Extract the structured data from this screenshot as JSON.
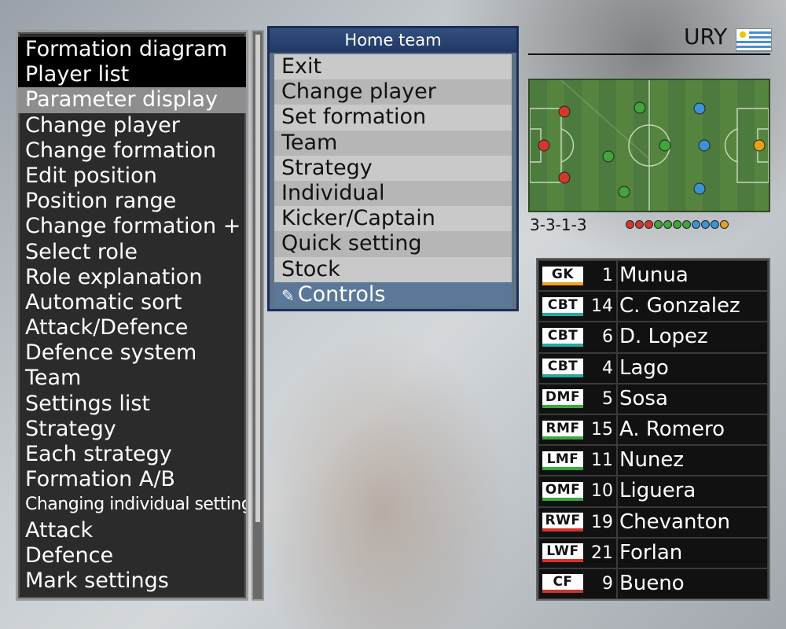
{
  "help_list": {
    "items": [
      {
        "label": "Formation diagram",
        "style": "dark"
      },
      {
        "label": "Player list",
        "style": "dark"
      },
      {
        "label": "Parameter display",
        "style": "hl"
      },
      {
        "label": "Change player",
        "style": ""
      },
      {
        "label": "Change formation",
        "style": ""
      },
      {
        "label": "Edit position",
        "style": ""
      },
      {
        "label": "Position range",
        "style": ""
      },
      {
        "label": "Change formation +",
        "style": ""
      },
      {
        "label": "Select role",
        "style": ""
      },
      {
        "label": "Role explanation",
        "style": ""
      },
      {
        "label": "Automatic sort",
        "style": ""
      },
      {
        "label": "Attack/Defence",
        "style": ""
      },
      {
        "label": "Defence system",
        "style": ""
      },
      {
        "label": "Team",
        "style": ""
      },
      {
        "label": "Settings list",
        "style": ""
      },
      {
        "label": "Strategy",
        "style": ""
      },
      {
        "label": "Each strategy",
        "style": ""
      },
      {
        "label": "Formation A/B",
        "style": ""
      },
      {
        "label": "Changing individual settings",
        "style": "small"
      },
      {
        "label": "Attack",
        "style": ""
      },
      {
        "label": "Defence",
        "style": ""
      },
      {
        "label": "Mark settings",
        "style": ""
      }
    ]
  },
  "menu": {
    "title": "Home team",
    "items": [
      "Exit",
      "Change player",
      "Set formation",
      "Team",
      "Strategy",
      "Individual",
      "Kicker/Captain",
      "Quick setting",
      "Stock"
    ],
    "controls_label": "Controls",
    "controls_icon": "controller-icon"
  },
  "team": {
    "code": "URY",
    "flag": "uruguay-flag"
  },
  "formation": {
    "label": "3-3-1-3",
    "dots": [
      {
        "color": "#d03a2c"
      },
      {
        "color": "#d03a2c"
      },
      {
        "color": "#d03a2c"
      },
      {
        "color": "#3fa63a"
      },
      {
        "color": "#3fa63a"
      },
      {
        "color": "#3fa63a"
      },
      {
        "color": "#3fa63a"
      },
      {
        "color": "#3b93d4"
      },
      {
        "color": "#3b93d4"
      },
      {
        "color": "#3b93d4"
      },
      {
        "color": "#e3a21a"
      }
    ]
  },
  "players": [
    {
      "pos": "GK",
      "num": "1",
      "name": "Munua",
      "line": "#f0a020"
    },
    {
      "pos": "CBT",
      "num": "14",
      "name": "C. Gonzalez",
      "line": "#2aa5a0"
    },
    {
      "pos": "CBT",
      "num": "6",
      "name": "D. Lopez",
      "line": "#2aa5a0"
    },
    {
      "pos": "CBT",
      "num": "4",
      "name": "Lago",
      "line": "#2aa5a0"
    },
    {
      "pos": "DMF",
      "num": "5",
      "name": "Sosa",
      "line": "#3aa83a"
    },
    {
      "pos": "RMF",
      "num": "15",
      "name": "A. Romero",
      "line": "#3aa83a"
    },
    {
      "pos": "LMF",
      "num": "11",
      "name": "Nunez",
      "line": "#3aa83a"
    },
    {
      "pos": "OMF",
      "num": "10",
      "name": "Liguera",
      "line": "#3aa83a"
    },
    {
      "pos": "RWF",
      "num": "19",
      "name": "Chevanton",
      "line": "#d0342c"
    },
    {
      "pos": "LWF",
      "num": "21",
      "name": "Forlan",
      "line": "#d0342c"
    },
    {
      "pos": "CF",
      "num": "9",
      "name": "Bueno",
      "line": "#d0342c"
    }
  ]
}
